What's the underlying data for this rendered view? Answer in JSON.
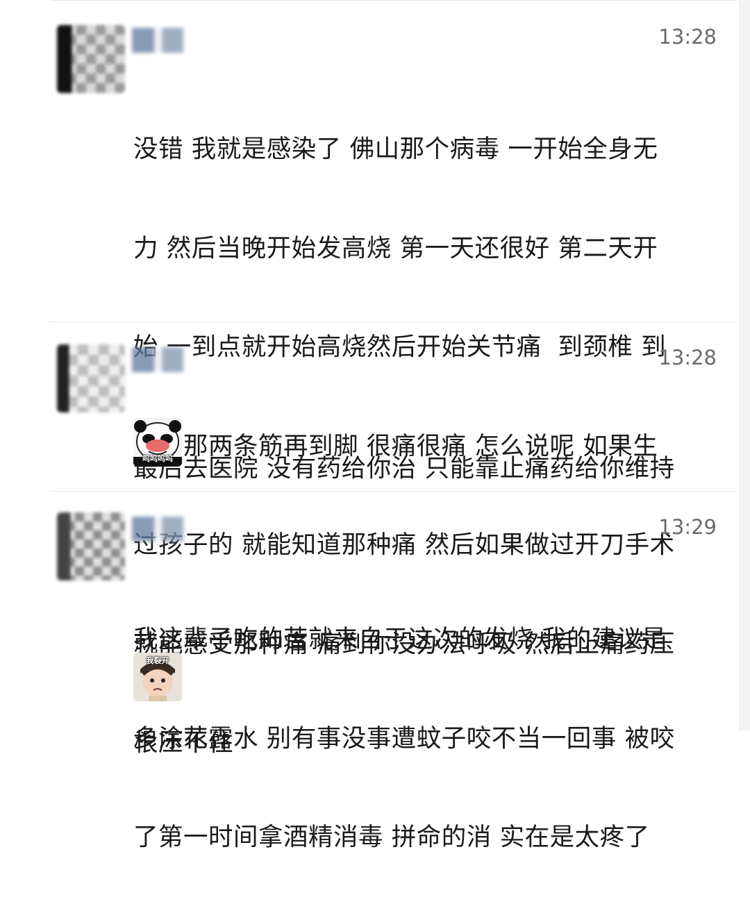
{
  "messages": [
    {
      "time": "13:28",
      "lines": [
        "没错 我就是感染了 佛山那个病毒 一开始全身无",
        "力 然后当晚开始发高烧 第一天还很好 第二天开",
        "始 一到点就开始高烧然后开始关节痛  到颈椎 到",
        "后背那两条筋再到脚 很痛很痛 怎么说呢 如果生",
        "过孩子的 就能知道那种痛 然后如果做过开刀手术",
        "就能感受那种痛 痛到你没办法呼吸 然后止痛药压",
        "根压不住"
      ]
    },
    {
      "time": "13:28",
      "lines": [
        "最后去医院 没有药给你治 只能靠止痛药给你维持"
      ],
      "sticker": {
        "caption": "呜呜呜呜",
        "icon": "crying-panda-sticker"
      }
    },
    {
      "time": "13:29",
      "lines": [
        "我这辈子吃的苦就来自于这次的发烧 我的建议是",
        "多涂花露水 别有事没事遭蚊子咬不当一回事 被咬",
        "了第一时间拿酒精消毒 拼命的消 实在是太疼了"
      ],
      "sticker": {
        "caption": "我裂开",
        "icon": "crying-child-sticker"
      }
    }
  ]
}
